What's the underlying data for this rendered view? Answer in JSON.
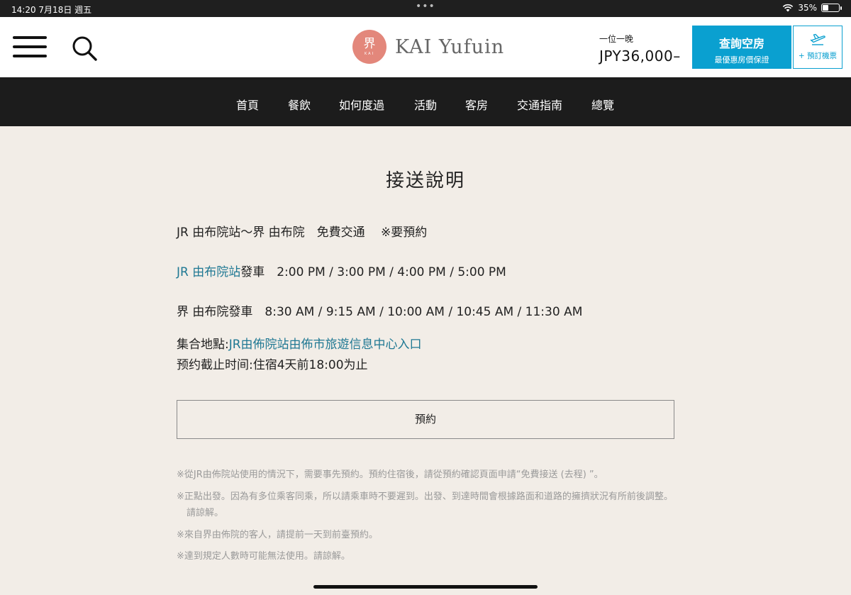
{
  "status_bar": {
    "time": "14:20",
    "date": "7月18日 週五",
    "dots": "•••",
    "battery": "35%",
    "battery_level": 0.35
  },
  "header": {
    "logo_mark": "界",
    "logo_mark_sub": "KAI",
    "logo_text": "KAI Yufuin",
    "price_label": "一位一晚",
    "price_value": "JPY36,000–",
    "search_rooms_label": "查詢空房",
    "search_rooms_sub": "最優惠房價保證",
    "flight_label": "+ 預訂機票"
  },
  "nav": {
    "items": [
      "首頁",
      "餐飲",
      "如何度過",
      "活動",
      "客房",
      "交通指南",
      "總覽"
    ]
  },
  "main": {
    "title": "接送說明",
    "intro": "JR 由布院站～界 由布院　免費交通　 ※要預約",
    "jr_station_link": "JR 由布院站",
    "jr_departure_suffix": "發車　2:00 PM / 3:00 PM / 4:00 PM / 5:00 PM",
    "kai_departure": "界 由布院發車　8:30 AM / 9:15 AM / 10:00 AM / 10:45 AM / 11:30 AM",
    "meeting_label": "集合地點:",
    "meeting_link": "JR由佈院站由佈市旅遊信息中心入口",
    "deadline": "预约截止时间:住宿4天前18:00为止",
    "reserve_button": "預約",
    "notes": [
      "※從JR由佈院站使用的情況下，需要事先預約。預約住宿後，請從預約確認頁面申請“免費接送 (去程) ”。",
      "※正點出發。因為有多位乘客同乘，所以請乘車時不要遲到。出發、到達時間會根據路面和道路的擁擠狀況有所前後調整。請諒解。",
      "※來自界由佈院的客人，請提前一天到前臺預約。",
      "※達到規定人數時可能無法使用。請諒解。"
    ]
  },
  "colors": {
    "accent": "#0aa0d0",
    "link": "#1f7893",
    "logo": "#e3877b",
    "nav_bg": "#1c1c1c",
    "page_bg": "#f2ede7"
  }
}
